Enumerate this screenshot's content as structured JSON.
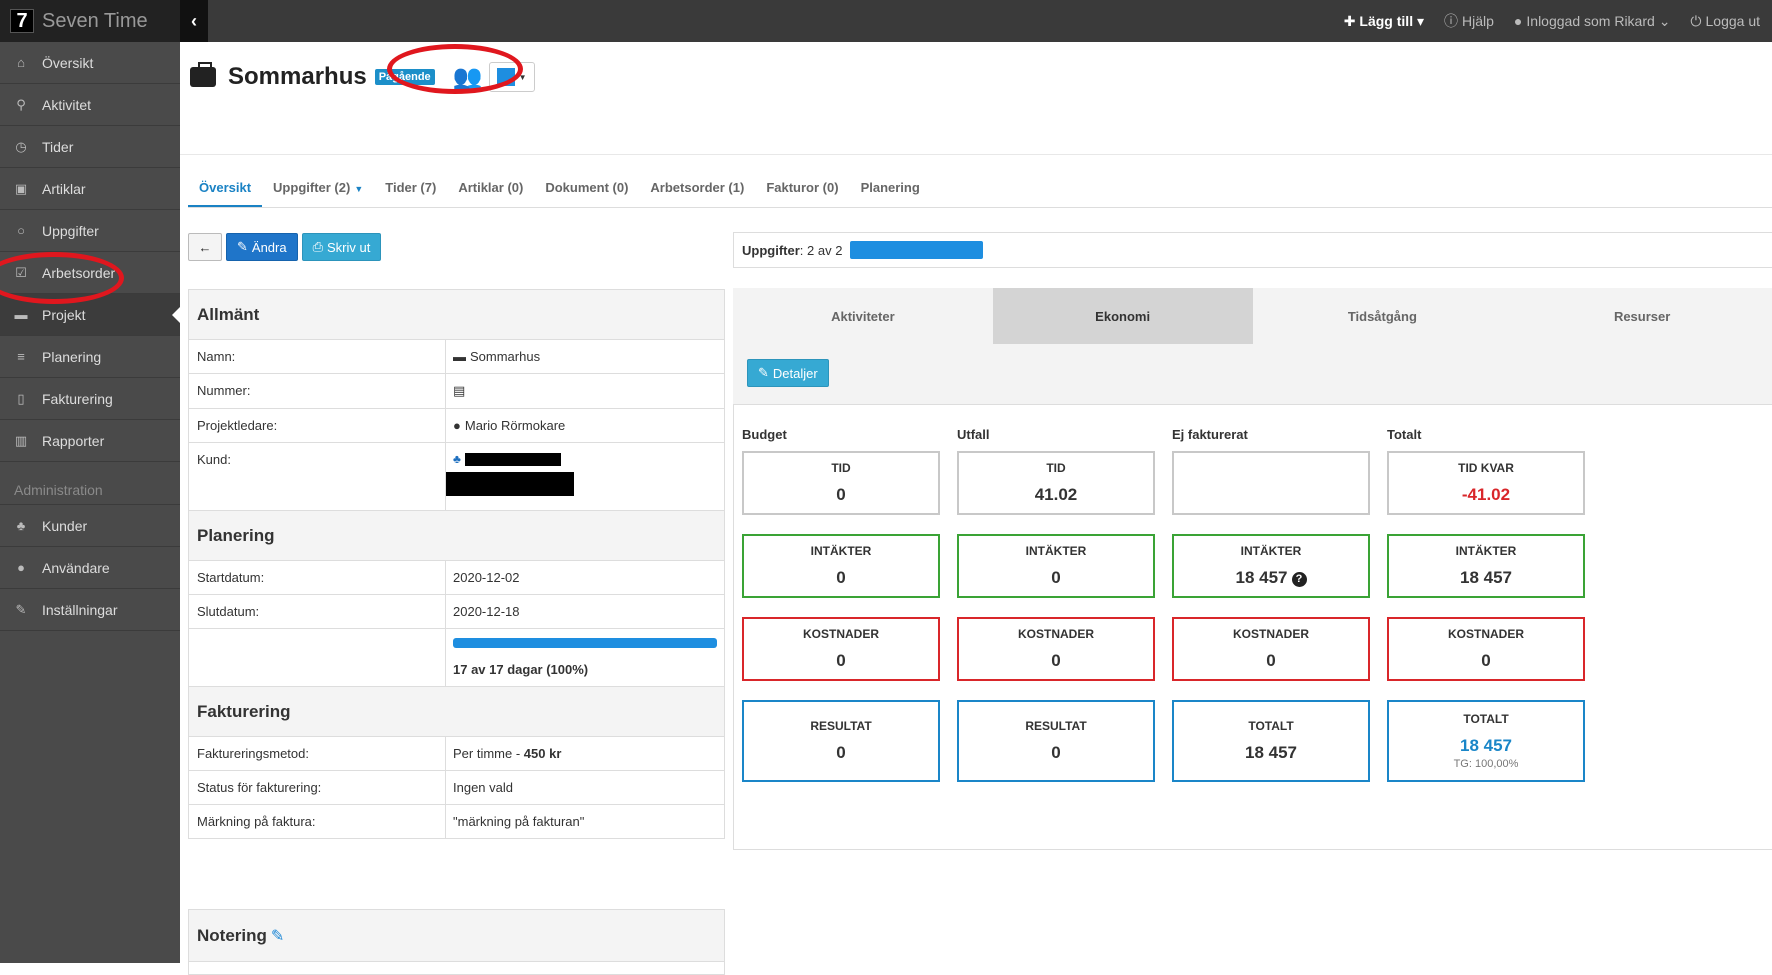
{
  "app": {
    "logo_char": "7",
    "name": "Seven Time",
    "collapse_icon": "chevron-left-icon"
  },
  "topbar": {
    "add_label": "Lägg till",
    "help_label": "Hjälp",
    "user_label": "Inloggad som Rikard",
    "logout_label": "Logga ut"
  },
  "sidebar": {
    "items": [
      {
        "label": "Översikt",
        "icon": "home-icon",
        "glyph": "⌂"
      },
      {
        "label": "Aktivitet",
        "icon": "map-marker-icon",
        "glyph": "⚲"
      },
      {
        "label": "Tider",
        "icon": "clock-icon",
        "glyph": "◷"
      },
      {
        "label": "Artiklar",
        "icon": "money-icon",
        "glyph": "▣"
      },
      {
        "label": "Uppgifter",
        "icon": "circle-icon",
        "glyph": "○"
      },
      {
        "label": "Arbetsorder",
        "icon": "check-square-icon",
        "glyph": "☑"
      },
      {
        "label": "Projekt",
        "icon": "briefcase-icon",
        "glyph": "▬"
      },
      {
        "label": "Planering",
        "icon": "list-icon",
        "glyph": "≡"
      },
      {
        "label": "Fakturering",
        "icon": "file-icon",
        "glyph": "▯"
      },
      {
        "label": "Rapporter",
        "icon": "bar-chart-icon",
        "glyph": "▥"
      }
    ],
    "admin_section": "Administration",
    "admin_items": [
      {
        "label": "Kunder",
        "icon": "sitemap-icon",
        "glyph": "♣"
      },
      {
        "label": "Användare",
        "icon": "user-icon",
        "glyph": "●"
      },
      {
        "label": "Inställningar",
        "icon": "wrench-icon",
        "glyph": "✎"
      }
    ]
  },
  "project": {
    "title": "Sommarhus",
    "status": "Pågående",
    "color": "#1e8ee0"
  },
  "tabs": [
    "Översikt",
    "Uppgifter (2)",
    "Tider (7)",
    "Artiklar (0)",
    "Dokument (0)",
    "Arbetsorder (1)",
    "Fakturor (0)",
    "Planering"
  ],
  "buttons": {
    "edit": "Ändra",
    "print": "Skriv ut",
    "details": "Detaljer"
  },
  "general": {
    "heading": "Allmänt",
    "rows": [
      {
        "key": "Namn:",
        "value": "Sommarhus"
      },
      {
        "key": "Nummer:",
        "value": ""
      },
      {
        "key": "Projektledare:",
        "value": "Mario Rörmokare"
      },
      {
        "key": "Kund:",
        "value": ""
      }
    ]
  },
  "planning": {
    "heading": "Planering",
    "start_key": "Startdatum:",
    "start": "2020-12-02",
    "end_key": "Slutdatum:",
    "end": "2020-12-18",
    "progress_fraction": 1.0,
    "progress_text": "17 av 17 dagar (100%)"
  },
  "billing": {
    "heading": "Fakturering",
    "method_key": "Faktureringsmetod:",
    "method_value": "Per timme - ",
    "method_price": "450 kr",
    "status_key": "Status för fakturering:",
    "status_value": "Ingen vald",
    "marking_key": "Märkning på faktura:",
    "marking_value": "\"märkning på fakturan\""
  },
  "note": {
    "heading": "Notering"
  },
  "tasks_progress": {
    "label": "Uppgifter",
    "text": ": 2 av 2",
    "fraction": 1.0
  },
  "right_tabs": [
    "Aktiviteter",
    "Ekonomi",
    "Tidsåtgång",
    "Resurser"
  ],
  "economy": {
    "columns": [
      "Budget",
      "Utfall",
      "Ej fakturerat",
      "Totalt"
    ],
    "rows": [
      [
        {
          "label": "TID",
          "value": "0"
        },
        {
          "label": "TID",
          "value": "41.02"
        },
        {
          "label": "",
          "value": ""
        },
        {
          "label": "TID KVAR",
          "value": "-41.02"
        }
      ],
      [
        {
          "label": "INTÄKTER",
          "value": "0"
        },
        {
          "label": "INTÄKTER",
          "value": "0"
        },
        {
          "label": "INTÄKTER",
          "value": "18 457"
        },
        {
          "label": "INTÄKTER",
          "value": "18 457"
        }
      ],
      [
        {
          "label": "KOSTNADER",
          "value": "0"
        },
        {
          "label": "KOSTNADER",
          "value": "0"
        },
        {
          "label": "KOSTNADER",
          "value": "0"
        },
        {
          "label": "KOSTNADER",
          "value": "0"
        }
      ],
      [
        {
          "label": "RESULTAT",
          "value": "0"
        },
        {
          "label": "RESULTAT",
          "value": "0"
        },
        {
          "label": "TOTALT",
          "value": "18 457"
        },
        {
          "label": "TOTALT",
          "value": "18 457",
          "sub": "TG: 100,00%"
        }
      ]
    ]
  }
}
